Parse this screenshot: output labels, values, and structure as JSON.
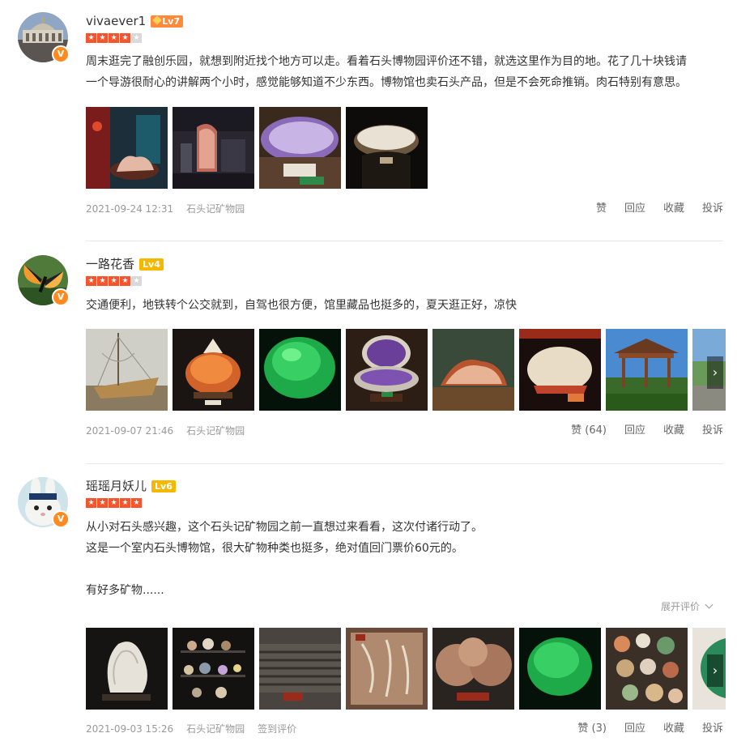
{
  "colors": {
    "accent": "#ff8a1f",
    "star": "#f5542e",
    "star_off": "#d9d9d9",
    "lv_orange": "#ff8a3c",
    "lv_yellow": "#f5b800"
  },
  "reviews": [
    {
      "username": "vivaever1",
      "level": "Lv7",
      "rating": 4,
      "lines": [
        "周末逛完了融创乐园，就想到附近找个地方可以走。看着石头博物园评价还不错，就选这里作为目的地。花了几十块钱请",
        "一个导游很耐心的讲解两个小时，感觉能够知道不少东西。博物馆也卖石头产品，但是不会死命推销。肉石特别有意思。"
      ],
      "date": "2021-09-24 12:31",
      "place": "石头记矿物园",
      "actions": {
        "like": "赞",
        "reply": "回应",
        "collect": "收藏",
        "report": "投诉"
      }
    },
    {
      "username": "一路花香",
      "level": "Lv4",
      "rating": 4,
      "lines": [
        "交通便利，地铁转个公交就到，自驾也很方便，馆里藏品也挺多的，夏天逛正好，凉快"
      ],
      "date": "2021-09-07 21:46",
      "place": "石头记矿物园",
      "actions": {
        "like": "赞 (64)",
        "reply": "回应",
        "collect": "收藏",
        "report": "投诉"
      }
    },
    {
      "username": "瑶瑶月妖儿",
      "level": "Lv6",
      "rating": 5,
      "lines": [
        "从小对石头感兴趣，这个石头记矿物园之前一直想过来看看，这次付诸行动了。",
        "这是一个室内石头博物馆，很大矿物种类也挺多，绝对值回门票价60元的。",
        "",
        "有好多矿物......"
      ],
      "expand": "展开评价",
      "date": "2021-09-03 15:26",
      "place": "石头记矿物园",
      "tag": "签到评价",
      "actions": {
        "like": "赞 (3)",
        "reply": "回应",
        "collect": "收藏",
        "report": "投诉"
      }
    }
  ],
  "icons": {
    "verified": "V",
    "next": "›",
    "chevron": "chevron-down-icon",
    "star": "star-icon"
  }
}
